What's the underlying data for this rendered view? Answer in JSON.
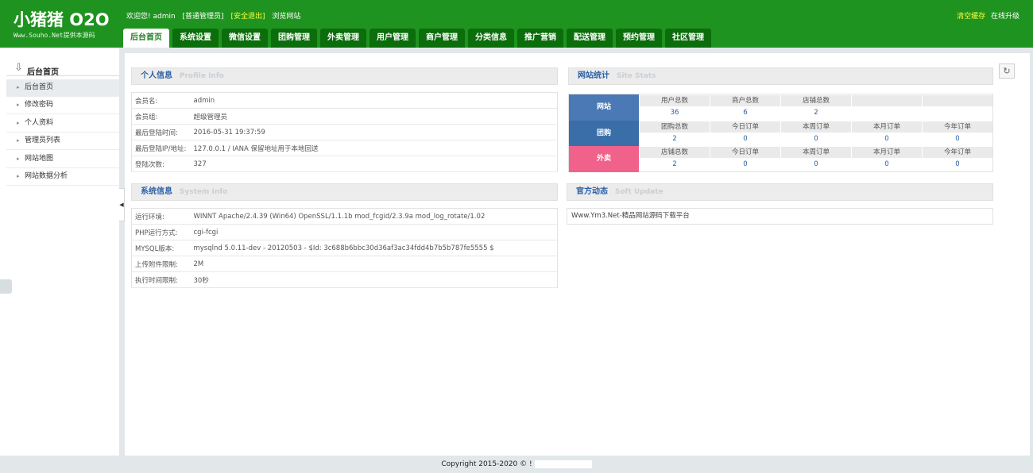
{
  "header": {
    "logo_title": "小猪猪 O2O",
    "logo_sub": "Www.Souho.Net提供本源码",
    "welcome": "欢迎您! admin",
    "role": "[普通管理员]",
    "logout": "[安全退出]",
    "browse": "浏览网站",
    "clear_cache": "清空缓存",
    "upgrade": "在线升级"
  },
  "tabs": [
    "后台首页",
    "系统设置",
    "微信设置",
    "团购管理",
    "外卖管理",
    "用户管理",
    "商户管理",
    "分类信息",
    "推广营销",
    "配送管理",
    "预约管理",
    "社区管理"
  ],
  "sidebar": {
    "title": "后台首页",
    "items": [
      "后台首页",
      "修改密码",
      "个人资料",
      "管理员列表",
      "网站地图",
      "网站数据分析"
    ]
  },
  "profile": {
    "title_cn": "个人信息",
    "title_en": "Profile  Info",
    "rows": [
      {
        "k": "会员名:",
        "v": "admin"
      },
      {
        "k": "会员组:",
        "v": "超级管理员"
      },
      {
        "k": "最后登陆时间:",
        "v": "2016-05-31 19:37:59"
      },
      {
        "k": "最后登陆IP/地址:",
        "v": "127.0.0.1 / IANA 保留地址用于本地回送"
      },
      {
        "k": "登陆次数:",
        "v": "327"
      }
    ]
  },
  "system": {
    "title_cn": "系统信息",
    "title_en": "System  Info",
    "rows": [
      {
        "k": "运行环境:",
        "v": "WINNT Apache/2.4.39 (Win64) OpenSSL/1.1.1b mod_fcgid/2.3.9a mod_log_rotate/1.02"
      },
      {
        "k": "PHP运行方式:",
        "v": "cgi-fcgi"
      },
      {
        "k": "MYSQL版本:",
        "v": "mysqlnd 5.0.11-dev - 20120503 - $Id: 3c688b6bbc30d36af3ac34fdd4b7b5b787fe5555 $"
      },
      {
        "k": "上传附件限制:",
        "v": "2M"
      },
      {
        "k": "执行时间限制:",
        "v": "30秒"
      }
    ]
  },
  "stats": {
    "title_cn": "网站统计",
    "title_en": "Site  Stats",
    "rows": [
      {
        "label": "网站",
        "color": "#4a79b5",
        "cells": [
          {
            "h": "用户总数",
            "n": "36"
          },
          {
            "h": "商户总数",
            "n": "6"
          },
          {
            "h": "店铺总数",
            "n": "2"
          },
          {
            "h": "",
            "n": ""
          },
          {
            "h": "",
            "n": ""
          }
        ]
      },
      {
        "label": "团购",
        "color": "#3a6ea8",
        "cells": [
          {
            "h": "团购总数",
            "n": "2"
          },
          {
            "h": "今日订单",
            "n": "0"
          },
          {
            "h": "本周订单",
            "n": "0"
          },
          {
            "h": "本月订单",
            "n": "0"
          },
          {
            "h": "今年订单",
            "n": "0"
          }
        ]
      },
      {
        "label": "外卖",
        "color": "#f0628c",
        "cells": [
          {
            "h": "店铺总数",
            "n": "2"
          },
          {
            "h": "今日订单",
            "n": "0"
          },
          {
            "h": "本周订单",
            "n": "0"
          },
          {
            "h": "本月订单",
            "n": "0"
          },
          {
            "h": "今年订单",
            "n": "0"
          }
        ]
      }
    ]
  },
  "soft": {
    "title_cn": "官方动态",
    "title_en": "Soft  Update",
    "text": "Www.Ym3.Net-精品网站源码下载平台"
  },
  "footer": {
    "copyright": "Copyright 2015-2020 © !"
  }
}
